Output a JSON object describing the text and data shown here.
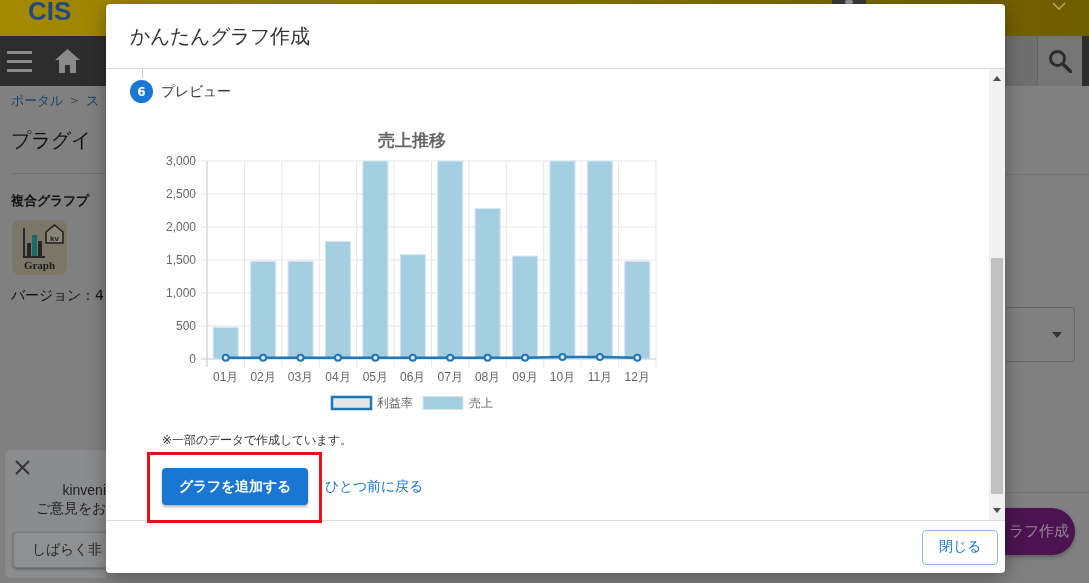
{
  "page": {
    "header": {
      "logo": "CIS"
    },
    "breadcrumb": {
      "items": [
        "ポータル",
        "ス"
      ],
      "separator": ">"
    },
    "page_title": "プラグイ",
    "plugin": {
      "name": "複合グラフプ",
      "icon": {
        "badge": "kv",
        "caption": "Graph"
      },
      "version": "バージョン：4"
    },
    "feedback_popup": {
      "lines": [
        "kinveni",
        "ご意見をお"
      ],
      "button": "しばらく非"
    },
    "create_button": "ラフ作成"
  },
  "dialog": {
    "title": "かんたんグラフ作成",
    "step": {
      "number": "6",
      "label": "プレビュー"
    },
    "chart_data": {
      "type": "bar",
      "title": "売上推移",
      "categories": [
        "01月",
        "02月",
        "03月",
        "04月",
        "05月",
        "06月",
        "07月",
        "08月",
        "09月",
        "10月",
        "11月",
        "12月"
      ],
      "series": [
        {
          "name": "利益率",
          "type": "line",
          "marker": "circle",
          "color": "#1f78b4",
          "values": [
            20,
            20,
            20,
            20,
            20,
            20,
            20,
            20,
            20,
            30,
            30,
            20
          ]
        },
        {
          "name": "売上",
          "type": "bar",
          "color": "#a6cee3",
          "values": [
            480,
            1480,
            1480,
            1780,
            3000,
            1580,
            3000,
            2280,
            1560,
            3000,
            3000,
            1480
          ]
        }
      ],
      "stacked": false,
      "grid": true,
      "legend": "bottom",
      "ylim": [
        0,
        3000
      ],
      "yticks": [
        0,
        500,
        {
          "value": 1000,
          "label": "1,000"
        },
        {
          "value": 1500,
          "label": "1,500"
        },
        {
          "value": 2000,
          "label": "2,000"
        },
        {
          "value": 2500,
          "label": "2,500"
        },
        {
          "value": 3000,
          "label": "3,000"
        }
      ]
    },
    "note": "※一部のデータで作成しています。",
    "add_button": "グラフを追加する",
    "back_link": "ひとつ前に戻る",
    "close_button": "閉じる"
  }
}
